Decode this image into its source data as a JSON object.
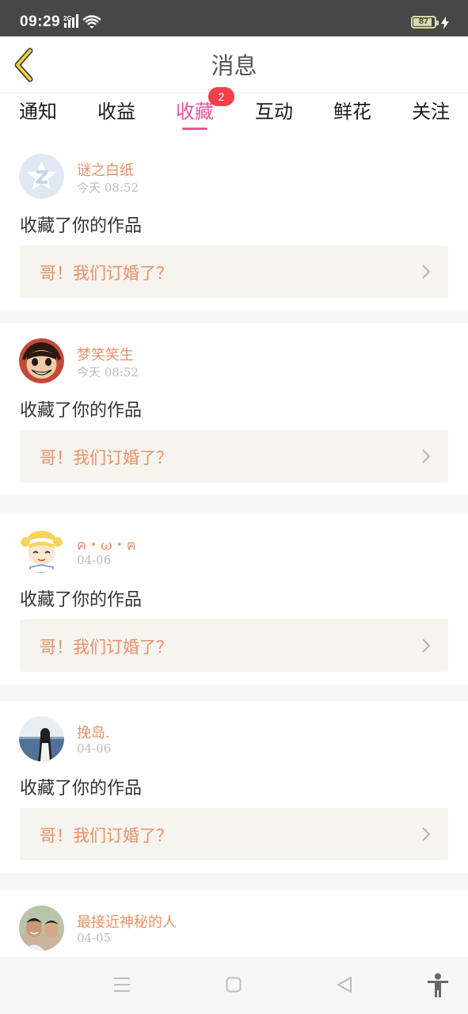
{
  "status_bar": {
    "time": "09:29",
    "network_label": "2G",
    "battery_percent": "87"
  },
  "header": {
    "title": "消息",
    "back_icon": "chevron-left-icon"
  },
  "tabs": [
    {
      "label": "通知",
      "active": false
    },
    {
      "label": "收益",
      "active": false
    },
    {
      "label": "收藏",
      "active": true,
      "badge": "2"
    },
    {
      "label": "互动",
      "active": false
    },
    {
      "label": "鲜花",
      "active": false
    },
    {
      "label": "关注",
      "active": false
    }
  ],
  "colors": {
    "accent": "#e8579b",
    "badge": "#f0404a",
    "name_color": "#e89069",
    "link_bg": "#f5f4ee"
  },
  "messages": [
    {
      "user": "谜之白纸",
      "time": "今天 08:52",
      "text": "收藏了你的作品",
      "work": "哥！我们订婚了？"
    },
    {
      "user": "梦笑笑生",
      "time": "今天 08:52",
      "text": "收藏了你的作品",
      "work": "哥！我们订婚了？"
    },
    {
      "user": "ฅ・ω・ฅ",
      "time": "04-06",
      "text": "收藏了你的作品",
      "work": "哥！我们订婚了？"
    },
    {
      "user": "挽岛.",
      "time": "04-06",
      "text": "收藏了你的作品",
      "work": "哥！我们订婚了？"
    },
    {
      "user": "最接近神秘的人",
      "time": "04-05",
      "text": "",
      "work": ""
    }
  ],
  "nav": {
    "icons": [
      "menu-icon",
      "home-square-icon",
      "back-triangle-icon",
      "accessibility-icon"
    ]
  }
}
